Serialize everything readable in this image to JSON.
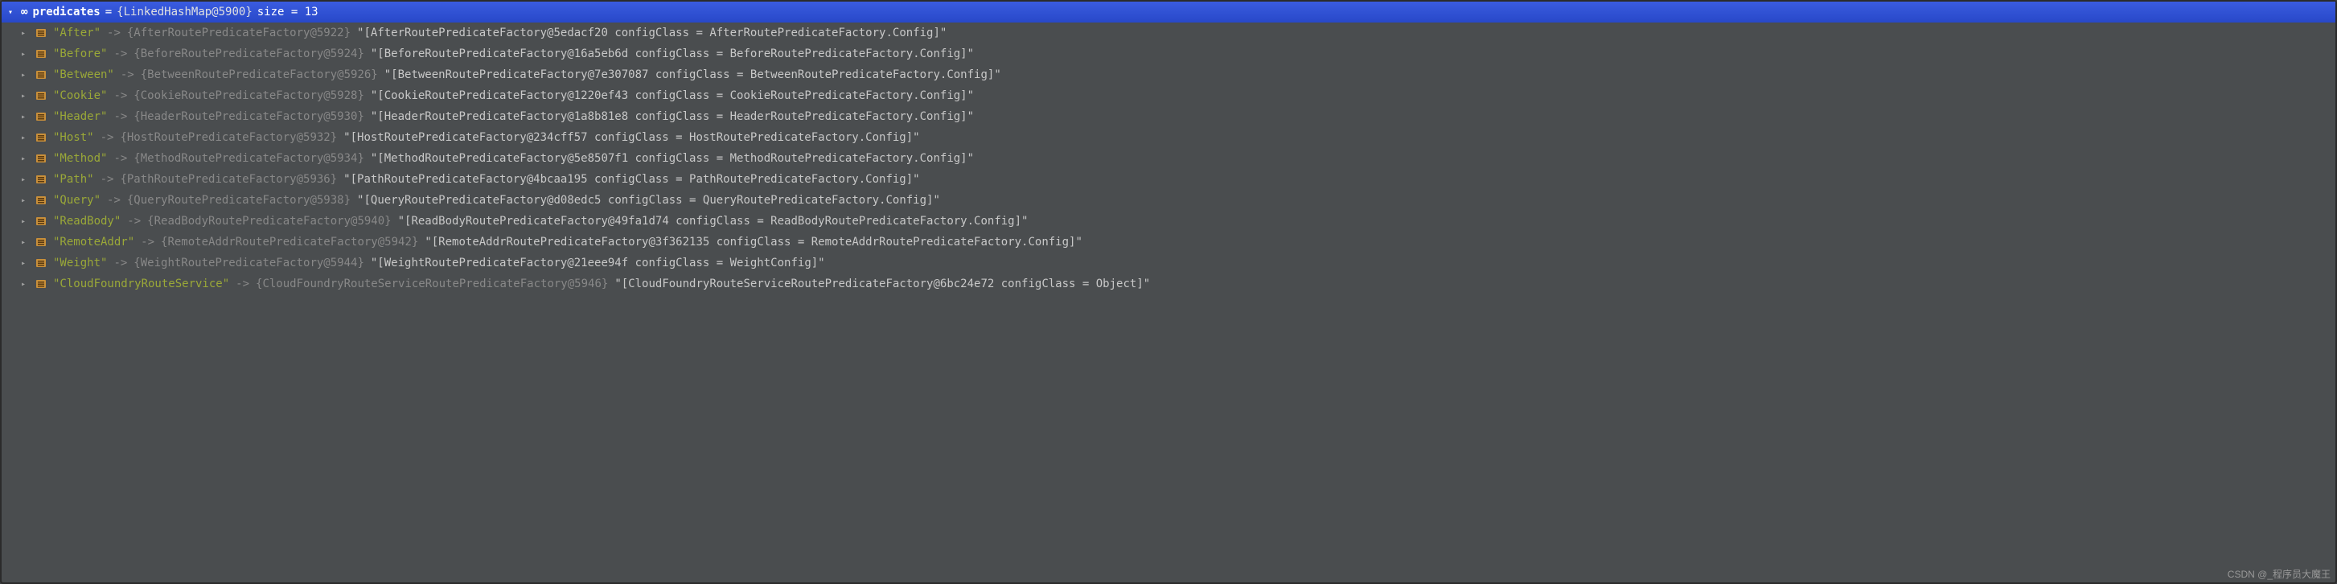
{
  "header": {
    "varName": "predicates",
    "equals": "=",
    "objRef": "{LinkedHashMap@5900}",
    "sizeLabel": " size = 13"
  },
  "entries": [
    {
      "key": "\"After\"",
      "arrow": "->",
      "valueRef": "{AfterRoutePredicateFactory@5922}",
      "valueStr": "\"[AfterRoutePredicateFactory@5edacf20 configClass = AfterRoutePredicateFactory.Config]\""
    },
    {
      "key": "\"Before\"",
      "arrow": "->",
      "valueRef": "{BeforeRoutePredicateFactory@5924}",
      "valueStr": "\"[BeforeRoutePredicateFactory@16a5eb6d configClass = BeforeRoutePredicateFactory.Config]\""
    },
    {
      "key": "\"Between\"",
      "arrow": "->",
      "valueRef": "{BetweenRoutePredicateFactory@5926}",
      "valueStr": "\"[BetweenRoutePredicateFactory@7e307087 configClass = BetweenRoutePredicateFactory.Config]\""
    },
    {
      "key": "\"Cookie\"",
      "arrow": "->",
      "valueRef": "{CookieRoutePredicateFactory@5928}",
      "valueStr": "\"[CookieRoutePredicateFactory@1220ef43 configClass = CookieRoutePredicateFactory.Config]\""
    },
    {
      "key": "\"Header\"",
      "arrow": "->",
      "valueRef": "{HeaderRoutePredicateFactory@5930}",
      "valueStr": "\"[HeaderRoutePredicateFactory@1a8b81e8 configClass = HeaderRoutePredicateFactory.Config]\""
    },
    {
      "key": "\"Host\"",
      "arrow": "->",
      "valueRef": "{HostRoutePredicateFactory@5932}",
      "valueStr": "\"[HostRoutePredicateFactory@234cff57 configClass = HostRoutePredicateFactory.Config]\""
    },
    {
      "key": "\"Method\"",
      "arrow": "->",
      "valueRef": "{MethodRoutePredicateFactory@5934}",
      "valueStr": "\"[MethodRoutePredicateFactory@5e8507f1 configClass = MethodRoutePredicateFactory.Config]\""
    },
    {
      "key": "\"Path\"",
      "arrow": "->",
      "valueRef": "{PathRoutePredicateFactory@5936}",
      "valueStr": "\"[PathRoutePredicateFactory@4bcaa195 configClass = PathRoutePredicateFactory.Config]\""
    },
    {
      "key": "\"Query\"",
      "arrow": "->",
      "valueRef": "{QueryRoutePredicateFactory@5938}",
      "valueStr": "\"[QueryRoutePredicateFactory@d08edc5 configClass = QueryRoutePredicateFactory.Config]\""
    },
    {
      "key": "\"ReadBody\"",
      "arrow": "->",
      "valueRef": "{ReadBodyRoutePredicateFactory@5940}",
      "valueStr": "\"[ReadBodyRoutePredicateFactory@49fa1d74 configClass = ReadBodyRoutePredicateFactory.Config]\""
    },
    {
      "key": "\"RemoteAddr\"",
      "arrow": "->",
      "valueRef": "{RemoteAddrRoutePredicateFactory@5942}",
      "valueStr": "\"[RemoteAddrRoutePredicateFactory@3f362135 configClass = RemoteAddrRoutePredicateFactory.Config]\""
    },
    {
      "key": "\"Weight\"",
      "arrow": "->",
      "valueRef": "{WeightRoutePredicateFactory@5944}",
      "valueStr": "\"[WeightRoutePredicateFactory@21eee94f configClass = WeightConfig]\""
    },
    {
      "key": "\"CloudFoundryRouteService\"",
      "arrow": "->",
      "valueRef": "{CloudFoundryRouteServiceRoutePredicateFactory@5946}",
      "valueStr": "\"[CloudFoundryRouteServiceRoutePredicateFactory@6bc24e72 configClass = Object]\""
    }
  ],
  "watermark": "CSDN @_程序员大魔王"
}
